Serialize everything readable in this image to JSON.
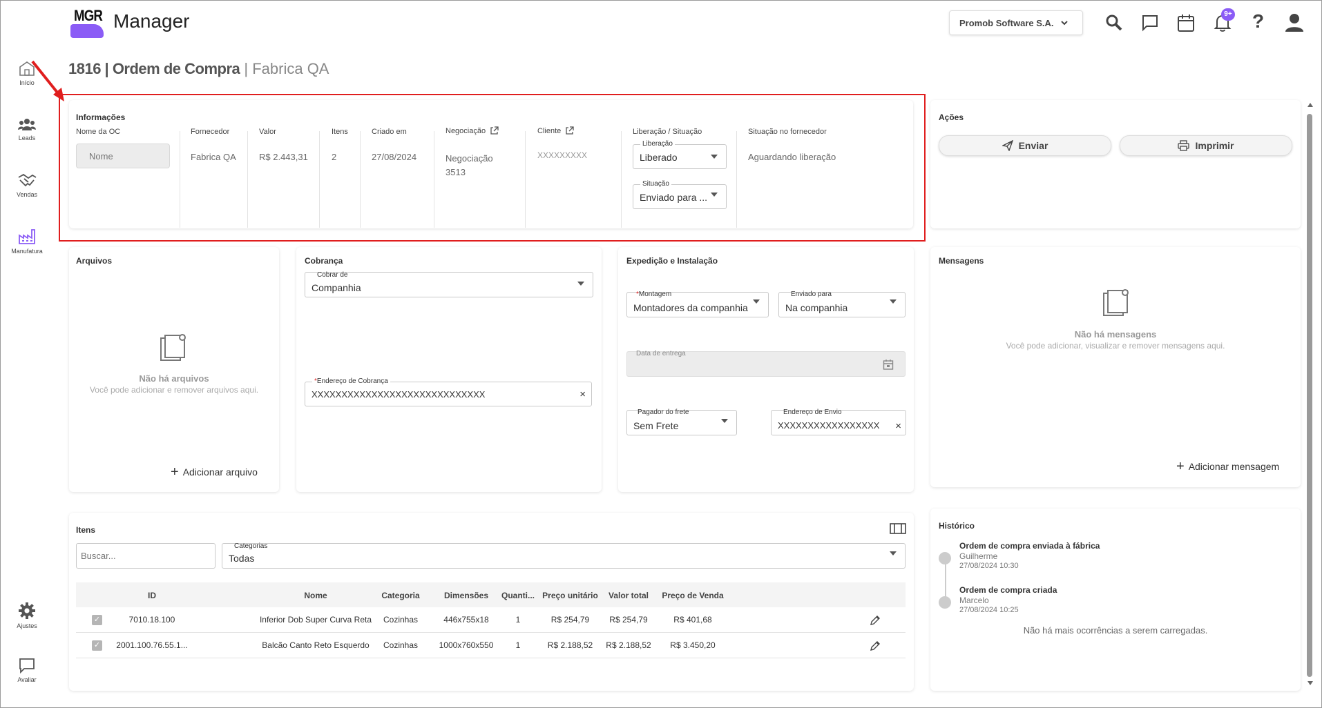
{
  "app": {
    "logo_text": "MGR",
    "title": "Manager"
  },
  "header": {
    "company": "Promob Software S.A.",
    "notification_badge": "9+",
    "icons": [
      "search-icon",
      "chat-icon",
      "calendar-icon",
      "bell-icon",
      "help-icon",
      "user-icon"
    ]
  },
  "sidebar": {
    "items": [
      {
        "label": "Início",
        "icon": "home-icon"
      },
      {
        "label": "Leads",
        "icon": "people-icon"
      },
      {
        "label": "Vendas",
        "icon": "handshake-icon"
      },
      {
        "label": "Manufatura",
        "icon": "factory-icon"
      }
    ],
    "bottom": [
      {
        "label": "Ajustes",
        "icon": "gear-icon"
      },
      {
        "label": "Avaliar",
        "icon": "feedback-icon"
      }
    ]
  },
  "page": {
    "title": "1816 | Ordem de Compra",
    "subtitle": "| Fabrica QA"
  },
  "info": {
    "heading": "Informações",
    "nome_label": "Nome da OC",
    "nome_placeholder": "Nome",
    "fornecedor_label": "Fornecedor",
    "fornecedor": "Fabrica QA",
    "valor_label": "Valor",
    "valor": "R$ 2.443,31",
    "itens_label": "Itens",
    "itens": "2",
    "criado_label": "Criado em",
    "criado": "27/08/2024",
    "negociacao_label": "Negociação",
    "negociacao_l1": "Negociação",
    "negociacao_l2": "3513",
    "cliente_label": "Cliente",
    "cliente": "XXXXXXXXX",
    "liberacao_header": "Liberação / Situação",
    "liberacao_label": "Liberação",
    "liberacao_value": "Liberado",
    "situacao_label": "Situação",
    "situacao_value": "Enviado para ...",
    "sit_fornecedor_label": "Situação no fornecedor",
    "sit_fornecedor": "Aguardando liberação"
  },
  "acoes": {
    "heading": "Ações",
    "enviar": "Enviar",
    "imprimir": "Imprimir"
  },
  "arquivos": {
    "heading": "Arquivos",
    "empty_title": "Não há arquivos",
    "empty_sub": "Você pode adicionar e remover arquivos aqui.",
    "add": "Adicionar arquivo"
  },
  "cobranca": {
    "heading": "Cobrança",
    "cobrar_label": "Cobrar de",
    "cobrar_value": "Companhia",
    "endereco_label": "Endereço de Cobrança",
    "endereco_value": "XXXXXXXXXXXXXXXXXXXXXXXXXXXXX"
  },
  "expedicao": {
    "heading": "Expedição e Instalação",
    "montagem_label": "Montagem",
    "montagem_value": "Montadores da companhia",
    "enviado_label": "Enviado para",
    "enviado_value": "Na companhia",
    "data_label": "Data de entrega",
    "pagador_label": "Pagador do frete",
    "pagador_value": "Sem Frete",
    "endereco_label": "Endereço de Envio",
    "endereco_value": "XXXXXXXXXXXXXXXXX"
  },
  "mensagens": {
    "heading": "Mensagens",
    "empty_title": "Não há mensagens",
    "empty_sub": "Você pode adicionar, visualizar e remover mensagens aqui.",
    "add": "Adicionar mensagem"
  },
  "itens": {
    "heading": "Itens",
    "search_placeholder": "Buscar...",
    "categorias_label": "Categorias",
    "categorias_value": "Todas",
    "columns": [
      "ID",
      "Nome",
      "Categoria",
      "Dimensões",
      "Quanti...",
      "Preço unitário",
      "Valor total",
      "Preço de Venda"
    ],
    "rows": [
      {
        "id": "7010.18.100",
        "nome": "Inferior Dob Super Curva Reta",
        "categoria": "Cozinhas",
        "dimensoes": "446x755x18",
        "qtd": "1",
        "preco_unit": "R$ 254,79",
        "valor_total": "R$ 254,79",
        "preco_venda": "R$ 401,68"
      },
      {
        "id": "2001.100.76.55.1...",
        "nome": "Balcão Canto Reto Esquerdo",
        "categoria": "Cozinhas",
        "dimensoes": "1000x760x550",
        "qtd": "1",
        "preco_unit": "R$ 2.188,52",
        "valor_total": "R$ 2.188,52",
        "preco_venda": "R$ 3.450,20"
      }
    ]
  },
  "historico": {
    "heading": "Histórico",
    "events": [
      {
        "title": "Ordem de compra enviada à fábrica",
        "user": "Guilherme",
        "date": "27/08/2024 10:30"
      },
      {
        "title": "Ordem de compra criada",
        "user": "Marcelo",
        "date": "27/08/2024 10:25"
      }
    ],
    "footer": "Não há mais ocorrências a serem carregadas."
  },
  "colors": {
    "accent": "#8b5cf6",
    "highlight": "#e01e1e"
  }
}
